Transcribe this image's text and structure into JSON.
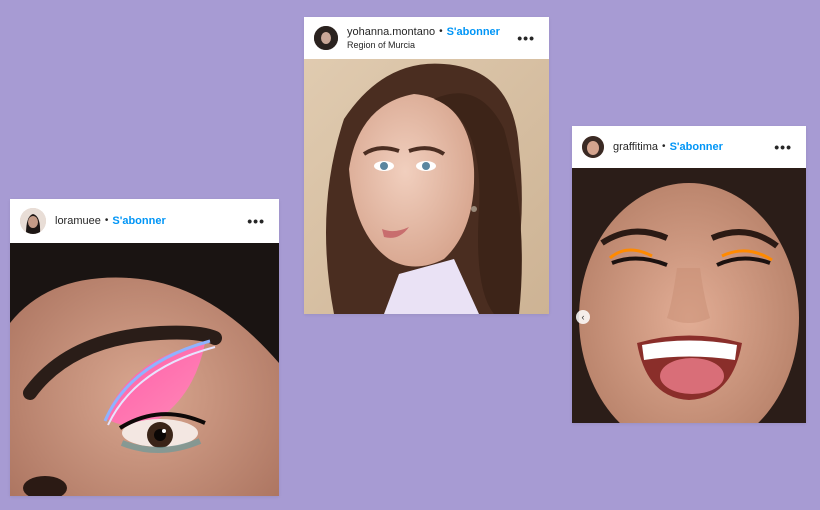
{
  "follow_label": "S'abonner",
  "separator": "•",
  "more_icon": "•••",
  "posts": [
    {
      "username": "loramuee",
      "location": ""
    },
    {
      "username": "yohanna.montano",
      "location": "Region of Murcia"
    },
    {
      "username": "graffitima",
      "location": ""
    }
  ],
  "carousel_prev_icon": "‹",
  "colors": {
    "background": "#a79bd3",
    "follow_link": "#0095f6",
    "text": "#262626"
  }
}
